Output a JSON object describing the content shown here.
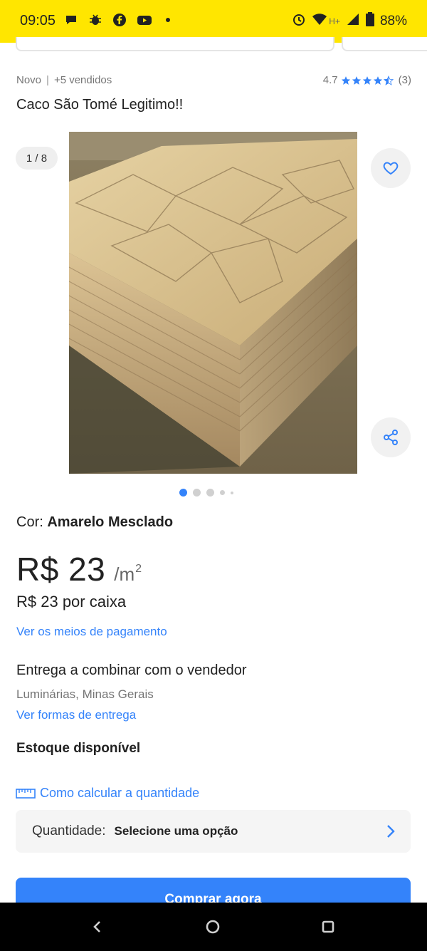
{
  "status_bar": {
    "time": "09:05",
    "battery": "88%",
    "network": "H+",
    "icons": [
      "chat-bubble-icon",
      "bug-icon",
      "facebook-icon",
      "youtube-icon",
      "dot-icon",
      "alarm-icon",
      "wifi-icon",
      "signal-icon",
      "battery-icon"
    ]
  },
  "listing": {
    "condition": "Novo",
    "separator": "|",
    "sold": "+5 vendidos",
    "rating": "4.7",
    "rating_value": 4.7,
    "rating_count": "(3)",
    "title": "Caco São Tomé Legitimo!!"
  },
  "gallery": {
    "counter": "1 / 8",
    "image": "stacked-stone-slabs-photo",
    "active_index": 0,
    "total": 8
  },
  "variant": {
    "label": "Cor:",
    "value": "Amarelo Mesclado"
  },
  "price": {
    "amount": "R$ 23",
    "unit": "/m",
    "unit_exp": "2",
    "per_box": "R$ 23 por caixa",
    "payment_link": "Ver os meios de pagamento"
  },
  "delivery": {
    "title": "Entrega a combinar com o vendedor",
    "location": "Luminárias, Minas Gerais",
    "shipping_link": "Ver formas de entrega"
  },
  "stock": {
    "label": "Estoque disponível"
  },
  "quantity": {
    "calc_link": "Como calcular a quantidade",
    "label": "Quantidade:",
    "value": "Selecione uma opção"
  },
  "actions": {
    "buy_now": "Comprar agora"
  },
  "colors": {
    "brand_yellow": "#ffe600",
    "accent_blue": "#3483fa"
  }
}
